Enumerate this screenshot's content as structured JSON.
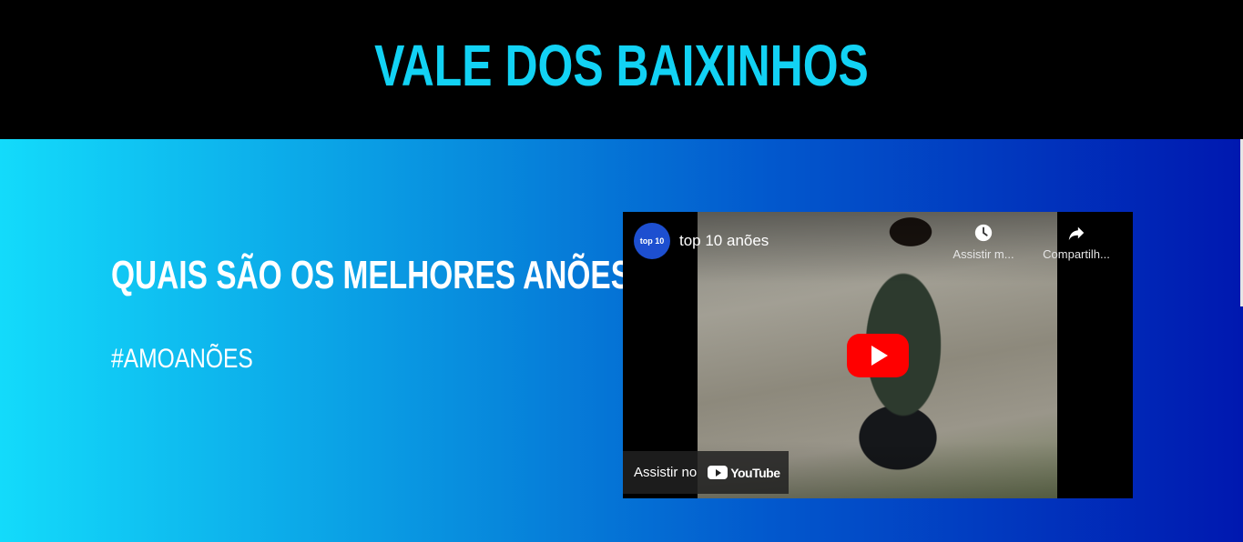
{
  "header": {
    "title": "VALE DOS BAIXINHOS"
  },
  "hero": {
    "headline": "QUAIS SÃO OS MELHORES ANÕES?",
    "hashtag": "#AMOANÕES"
  },
  "video": {
    "channel_avatar_text": "top 10",
    "title": "top 10 anões",
    "watch_later_label": "Assistir m...",
    "share_label": "Compartilh...",
    "watch_on_label": "Assistir no",
    "youtube_wordmark": "YouTube"
  },
  "colors": {
    "title": "#12d2f4",
    "gradient_start": "#13dbfb",
    "gradient_end": "#0018b0",
    "play_button": "#ff0000"
  },
  "icons": {
    "watch_later": "clock-icon",
    "share": "share-arrow-icon",
    "play": "play-icon"
  }
}
